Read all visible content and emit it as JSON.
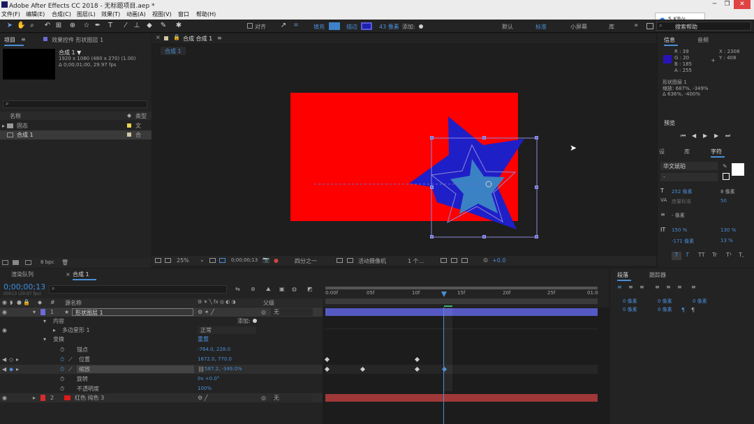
{
  "titlebar": {
    "title": "Adobe After Effects CC 2018 - 无标题项目.aep *"
  },
  "menu": [
    "文件(F)",
    "编辑(E)",
    "合成(C)",
    "图层(L)",
    "效果(T)",
    "动画(A)",
    "视图(V)",
    "窗口",
    "帮助(H)"
  ],
  "net_badge": "5 KB/s",
  "toolbar": {
    "align": "对齐",
    "fill": "填充",
    "stroke": "描边",
    "stroke_px": "43 像素",
    "add": "添加:",
    "workspaces": [
      "默认",
      "标准",
      "小屏幕",
      "库"
    ],
    "search": "搜索帮助"
  },
  "project": {
    "tab": "项目",
    "tab_menu": "≡",
    "effects_tab": "效果控件 形状图层 1",
    "comp_name": "合成 1 ▼",
    "comp_info1": "1920 x 1080 (480 x 270) (1.00)",
    "comp_info2": "Δ 0;00;01;00, 29.97 fps",
    "col_name": "名称",
    "col_type": "类型",
    "items": [
      {
        "name": "固态",
        "type": "文"
      },
      {
        "name": "合成 1",
        "type": "合"
      }
    ],
    "bpc": "8 bpc"
  },
  "comp": {
    "tab": "合成 合成 1",
    "sub_tab": "合成 1",
    "zoom": "25%",
    "timecode": "0;00;00;13",
    "view": "四分之一",
    "camera": "活动摄像机",
    "views": "1 个...",
    "exposure": "+0.0"
  },
  "info": {
    "tab": "信息",
    "audio_tab": "音频",
    "r": "R : 39",
    "g": "G : 20",
    "b": "B : 185",
    "a": "A : 255",
    "x": "X : 2308",
    "y": "Y : 408",
    "layer": "形状图层 1",
    "scale1": "缩放: 687%, -349%",
    "scale2": "Δ 636%, -400%",
    "color": "#2714b9"
  },
  "preview": {
    "tab": "预览"
  },
  "character": {
    "tabs": [
      "设",
      "库",
      "字符"
    ],
    "font": "华文琥珀",
    "style": "-",
    "size": "252 像素",
    "leading": "8 像素",
    "kern": "度量标准",
    "track": "50",
    "stroke_w": "- 像素",
    "vscale": "150 %",
    "hscale": "130 %",
    "baseline": "-171 像素",
    "tsume": "13 %",
    "styles": [
      "T",
      "T",
      "TT",
      "Tr",
      "T¹",
      "T,"
    ]
  },
  "timeline": {
    "render_tab": "渲染队列",
    "comp_tab": "合成 1",
    "timecode": "0;00;00;13",
    "fps": "00013 (29.97 fps)",
    "col_num": "#",
    "col_name": "源名称",
    "col_parent": "父级",
    "ruler": [
      "0:00f",
      "05f",
      "10f",
      "15f",
      "20f",
      "25f",
      "01:0"
    ]
  },
  "layers": [
    {
      "num": "1",
      "name": "形状图层 1",
      "parent": "无",
      "color": "#6b6bd9"
    },
    {
      "num": "2",
      "name": "红色 纯色 3",
      "parent": "无",
      "color": "#d92b2b"
    }
  ],
  "props": [
    {
      "label": "内容",
      "value": "",
      "add": "添加:"
    },
    {
      "label": "多边星形 1",
      "value": "正常"
    },
    {
      "label": "变换",
      "value": "重置"
    },
    {
      "label": "锚点",
      "value": "-764.0, 228.0"
    },
    {
      "label": "位置",
      "value": "1672.0, 770.0"
    },
    {
      "label": "缩放",
      "value": "587.2, -349.0%"
    },
    {
      "label": "旋转",
      "value": "0x +0.0°"
    },
    {
      "label": "不透明度",
      "value": "100%"
    }
  ],
  "paragraph": {
    "tab": "段落",
    "tracker_tab": "跟踪器",
    "px": [
      "0 像素",
      "0 像素",
      "0 像素",
      "0 像素",
      "0 像素"
    ]
  }
}
